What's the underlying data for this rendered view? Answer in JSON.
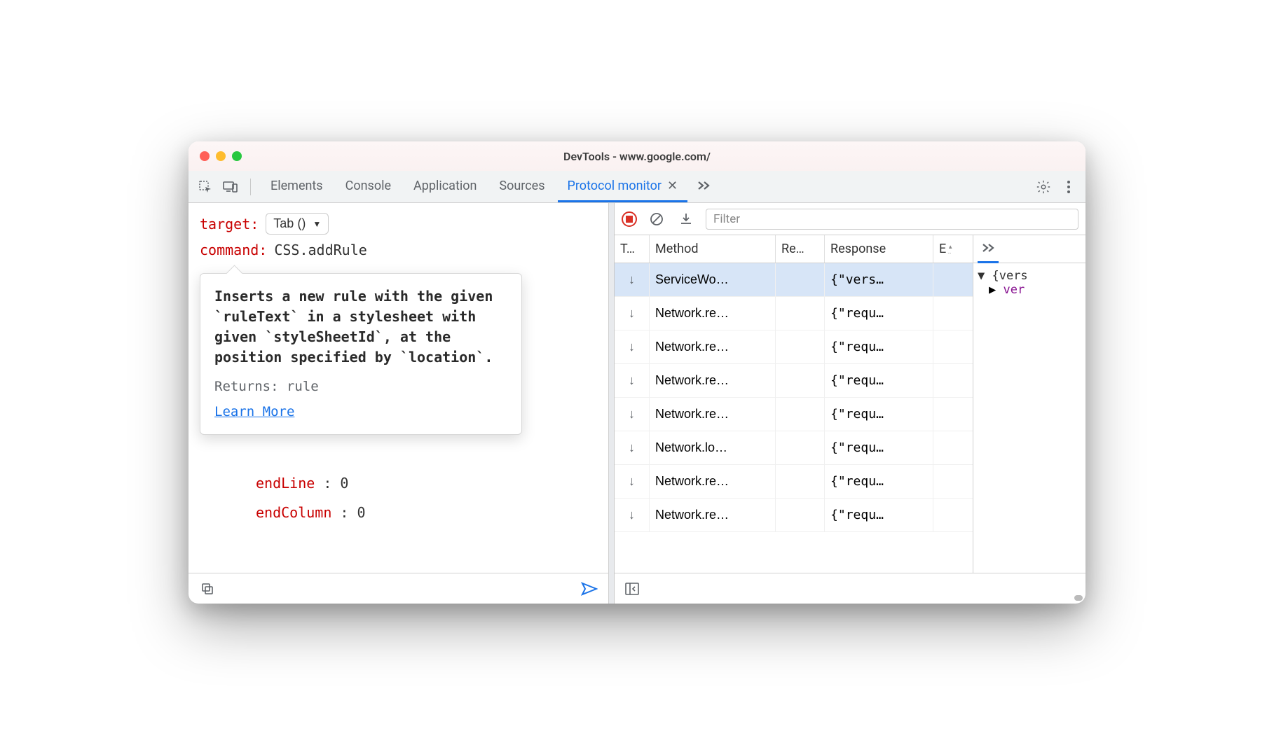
{
  "window": {
    "title": "DevTools - www.google.com/"
  },
  "tabs": {
    "items": [
      "Elements",
      "Console",
      "Application",
      "Sources",
      "Protocol monitor"
    ],
    "active": "Protocol monitor"
  },
  "left": {
    "target_label": "target",
    "target_value": "Tab ()",
    "command_label": "command",
    "command_value": "CSS.addRule",
    "tooltip": {
      "desc_pre": "Inserts a new rule with the given ",
      "code1": "`ruleText`",
      "desc_mid1": " in a stylesheet with given ",
      "code2": "`styleSheetId`",
      "desc_mid2": ", at the position specified by ",
      "code3": "`location`",
      "desc_end": ".",
      "returns": "Returns: rule",
      "learn": "Learn More"
    },
    "params": [
      {
        "key": "endLine",
        "value": "0"
      },
      {
        "key": "endColumn",
        "value": "0"
      }
    ]
  },
  "filter_placeholder": "Filter",
  "columns": {
    "type": "T…",
    "method": "Method",
    "request": "Re…",
    "response": "Response",
    "elapsed": "E"
  },
  "rows": [
    {
      "dir": "↓",
      "method": "ServiceWo…",
      "response": "{\"vers…",
      "selected": true
    },
    {
      "dir": "↓",
      "method": "Network.re…",
      "response": "{\"requ…"
    },
    {
      "dir": "↓",
      "method": "Network.re…",
      "response": "{\"requ…"
    },
    {
      "dir": "↓",
      "method": "Network.re…",
      "response": "{\"requ…"
    },
    {
      "dir": "↓",
      "method": "Network.re…",
      "response": "{\"requ…"
    },
    {
      "dir": "↓",
      "method": "Network.lo…",
      "response": "{\"requ…"
    },
    {
      "dir": "↓",
      "method": "Network.re…",
      "response": "{\"requ…"
    },
    {
      "dir": "↓",
      "method": "Network.re…",
      "response": "{\"requ…"
    }
  ],
  "detail": {
    "l1": "{vers",
    "l2key": "ver"
  }
}
